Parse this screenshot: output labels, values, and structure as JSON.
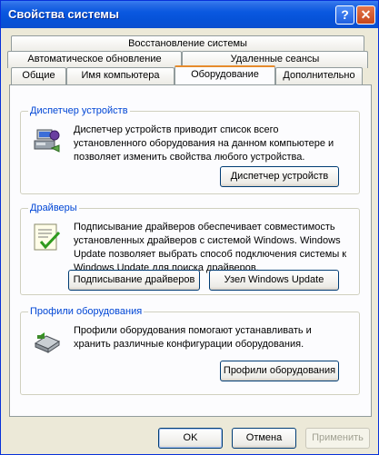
{
  "window": {
    "title": "Свойства системы",
    "help_glyph": "?",
    "close_glyph": "✕"
  },
  "tabs": {
    "row1": [
      "Восстановление системы"
    ],
    "row2": [
      "Автоматическое обновление",
      "Удаленные сеансы"
    ],
    "row3": [
      "Общие",
      "Имя компьютера",
      "Оборудование",
      "Дополнительно"
    ],
    "active": "Оборудование"
  },
  "device_manager": {
    "title": "Диспетчер устройств",
    "icon": "device-manager-icon",
    "text": "Диспетчер устройств приводит список всего установленного оборудования на данном компьютере и позволяет изменить свойства любого устройства.",
    "button": "Диспетчер устройств"
  },
  "drivers": {
    "title": "Драйверы",
    "icon": "driver-signing-icon",
    "text": "Подписывание драйверов обеспечивает совместимость установленных драйверов с системой Windows. Windows Update позволяет выбрать способ подключения системы к Windows Update для поиска драйверов.",
    "signing_button": "Подписывание драйверов",
    "update_button": "Узел Windows Update"
  },
  "hardware_profiles": {
    "title": "Профили оборудования",
    "icon": "hardware-profiles-icon",
    "text": "Профили оборудования помогают устанавливать и хранить различные конфигурации оборудования.",
    "button": "Профили оборудования"
  },
  "footer": {
    "ok": "OK",
    "cancel": "Отмена",
    "apply": "Применить"
  }
}
